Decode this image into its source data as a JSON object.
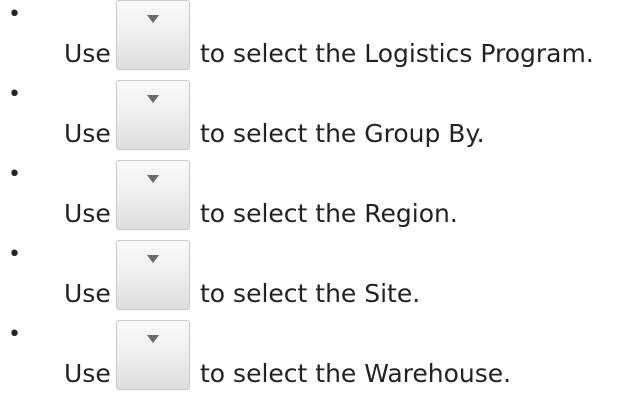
{
  "bullet_glyph": "•",
  "items": [
    {
      "prefix": "Use",
      "text": "to select the Logistics Program.",
      "icon": "chevron-down-icon"
    },
    {
      "prefix": "Use",
      "text": "to select the Group By.",
      "icon": "chevron-down-icon"
    },
    {
      "prefix": "Use",
      "text": "to select the Region.",
      "icon": "chevron-down-icon"
    },
    {
      "prefix": "Use",
      "text": "to select the Site.",
      "icon": "chevron-down-icon"
    },
    {
      "prefix": "Use",
      "text": "to select the Warehouse.",
      "icon": "chevron-down-icon"
    }
  ]
}
